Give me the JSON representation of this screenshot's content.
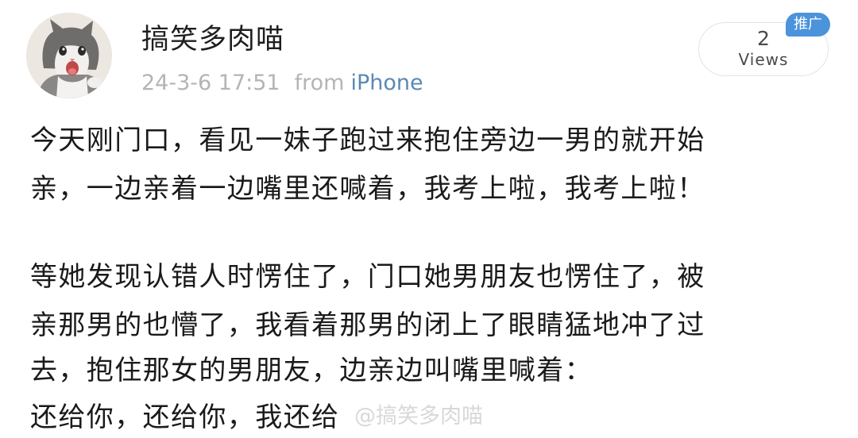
{
  "post": {
    "author": "搞笑多肉喵",
    "date": "24-3-6 17:51",
    "from_label": "from",
    "device": "iPhone",
    "views_count": "2",
    "views_label": "Views",
    "promo_tag": "推广",
    "lines": [
      "今天刚门口，看见一妹子跑过来抱住旁边一男的就开始",
      "亲，一边亲着一边嘴里还喊着，我考上啦，我考上啦！",
      "等她发现认错人时愣住了，门口她男朋友也愣住了，被",
      "亲那男的也懵了，我看着那男的闭上了眼睛猛地冲了过",
      "去，抱住那女的男朋友，边亲边叫嘴里喊着：",
      "还给你，还给你，我还给"
    ],
    "watermark": "@搞笑多肉喵"
  },
  "colors": {
    "text": "#1a1a1a",
    "meta_gray": "#b4b4b4",
    "link_blue": "#5b88b3",
    "promo_blue": "#4b93db"
  },
  "icons": {
    "avatar": "cat-avatar-icon"
  }
}
